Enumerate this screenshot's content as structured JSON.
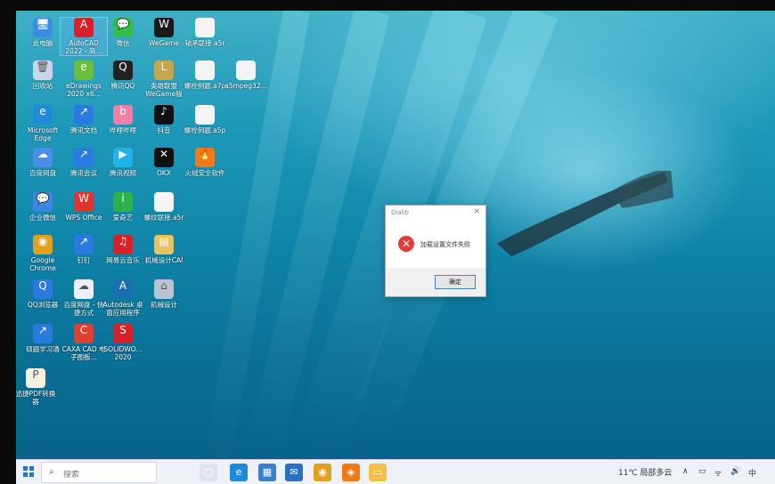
{
  "desktop": {
    "icons": [
      {
        "label": "此电脑",
        "name": "this-pc-icon",
        "glyph": "🖥",
        "color": "#3b8de0"
      },
      {
        "label": "AutoCAD 2022 - 简...",
        "name": "autocad-icon",
        "glyph": "A",
        "color": "#d8202a"
      },
      {
        "label": "微信",
        "name": "wechat-icon",
        "glyph": "💬",
        "color": "#2fbf4a"
      },
      {
        "label": "WeGame",
        "name": "wegame-icon",
        "glyph": "W",
        "color": "#1a1a1a"
      },
      {
        "label": "轴承联接.a5r",
        "name": "file-icon",
        "glyph": "",
        "color": "#f4f4f4"
      },
      {
        "label": "回收站",
        "name": "recycle-bin-icon",
        "glyph": "🗑",
        "color": "#c8d6e6"
      },
      {
        "label": "eDrawings 2020 x6...",
        "name": "edrawings-icon",
        "glyph": "e",
        "color": "#6bbf3a"
      },
      {
        "label": "腾讯QQ",
        "name": "qq-icon",
        "glyph": "Q",
        "color": "#222"
      },
      {
        "label": "英雄联盟 WeGame版",
        "name": "league-icon",
        "glyph": "L",
        "color": "#c9a44a"
      },
      {
        "label": "螺栓例题.a7p",
        "name": "file-icon",
        "glyph": "",
        "color": "#f4f4f4"
      },
      {
        "label": "a5mpeg32...",
        "name": "file-icon",
        "glyph": "",
        "color": "#f4f4f4"
      },
      {
        "label": "Microsoft Edge",
        "name": "edge-icon",
        "glyph": "e",
        "color": "#1f8bd8"
      },
      {
        "label": "腾讯文档",
        "name": "tencent-docs-icon",
        "glyph": "↗",
        "color": "#2a7ae2"
      },
      {
        "label": "哔哩哔哩",
        "name": "bilibili-icon",
        "glyph": "b",
        "color": "#f27ea8"
      },
      {
        "label": "抖音",
        "name": "douyin-icon",
        "glyph": "♪",
        "color": "#111"
      },
      {
        "label": "螺栓例题.a5p",
        "name": "file-icon",
        "glyph": "",
        "color": "#f4f4f4"
      },
      {
        "label": "百度网盘",
        "name": "baidu-netdisk-icon",
        "glyph": "☁",
        "color": "#4a8fe7"
      },
      {
        "label": "腾讯会议",
        "name": "tencent-meeting-icon",
        "glyph": "↗",
        "color": "#2a7ae2"
      },
      {
        "label": "腾讯视频",
        "name": "tencent-video-icon",
        "glyph": "▶",
        "color": "#1fb3e8"
      },
      {
        "label": "OKX",
        "name": "okx-icon",
        "glyph": "✕",
        "color": "#111"
      },
      {
        "label": "火绒安全软件",
        "name": "huorong-icon",
        "glyph": "🔥",
        "color": "#f07a1a"
      },
      {
        "label": "企业微信",
        "name": "wecom-icon",
        "glyph": "💬",
        "color": "#3a86e0"
      },
      {
        "label": "WPS Office",
        "name": "wps-icon",
        "glyph": "W",
        "color": "#e2332f"
      },
      {
        "label": "爱奇艺",
        "name": "iqiyi-icon",
        "glyph": "i",
        "color": "#2bb24c"
      },
      {
        "label": "螺纹联接.a5r",
        "name": "file-icon",
        "glyph": "",
        "color": "#f4f4f4"
      },
      {
        "label": "Google Chrome",
        "name": "chrome-icon",
        "glyph": "◉",
        "color": "#e0a020"
      },
      {
        "label": "钉钉",
        "name": "dingtalk-icon",
        "glyph": "↗",
        "color": "#2a7ae2"
      },
      {
        "label": "网易云音乐",
        "name": "netease-music-icon",
        "glyph": "♫",
        "color": "#d8202a"
      },
      {
        "label": "机械设计CAI",
        "name": "cai-icon",
        "glyph": "▤",
        "color": "#e8c25a"
      },
      {
        "label": "QQ浏览器",
        "name": "qq-browser-icon",
        "glyph": "Q",
        "color": "#2a7ae2"
      },
      {
        "label": "百度网盘 - 快捷方式",
        "name": "baidu-netdisk-shortcut-icon",
        "glyph": "☁",
        "color": "#eef"
      },
      {
        "label": "Autodesk 桌面应用程序",
        "name": "autodesk-icon",
        "glyph": "A",
        "color": "#1a6fb0"
      },
      {
        "label": "机械设计",
        "name": "mech-design-icon",
        "glyph": "⌂",
        "color": "#b8c4d0"
      },
      {
        "label": "硕题学习通",
        "name": "xuexitong-icon",
        "glyph": "↗",
        "color": "#2a7ae2"
      },
      {
        "label": "CAXA CAD 电子图板...",
        "name": "caxa-icon",
        "glyph": "C",
        "color": "#e04030"
      },
      {
        "label": "SOLIDWO... 2020",
        "name": "solidworks-icon",
        "glyph": "S",
        "color": "#d8202a"
      },
      {
        "label": "迅捷PDF转换器",
        "name": "pdf-converter-icon",
        "glyph": "P",
        "color": "#f5f0e0"
      }
    ]
  },
  "dialog": {
    "title": "Dialib",
    "close_glyph": "×",
    "message": "加载设置文件失败",
    "ok_label": "确定",
    "error_glyph": "✕"
  },
  "taskbar": {
    "search_placeholder": "搜索",
    "weather": "11℃ 局部多云",
    "tray_up": "∧",
    "tray_battery": "▭",
    "tray_wifi": "ᯤ",
    "tray_volume": "🔊",
    "tray_ime": "中",
    "apps": [
      {
        "name": "taskview-icon",
        "glyph": "▢",
        "color": "#dfe5ec"
      },
      {
        "name": "edge-taskbar-icon",
        "glyph": "e",
        "color": "#1f8bd8"
      },
      {
        "name": "store-taskbar-icon",
        "glyph": "▦",
        "color": "#3a7fd0"
      },
      {
        "name": "mail-taskbar-icon",
        "glyph": "✉",
        "color": "#2a6fc0"
      },
      {
        "name": "chrome-taskbar-icon",
        "glyph": "◉",
        "color": "#e0a020"
      },
      {
        "name": "firefox-taskbar-icon",
        "glyph": "◈",
        "color": "#f07a1a"
      },
      {
        "name": "explorer-taskbar-icon",
        "glyph": "▭",
        "color": "#f2c04a"
      }
    ]
  }
}
